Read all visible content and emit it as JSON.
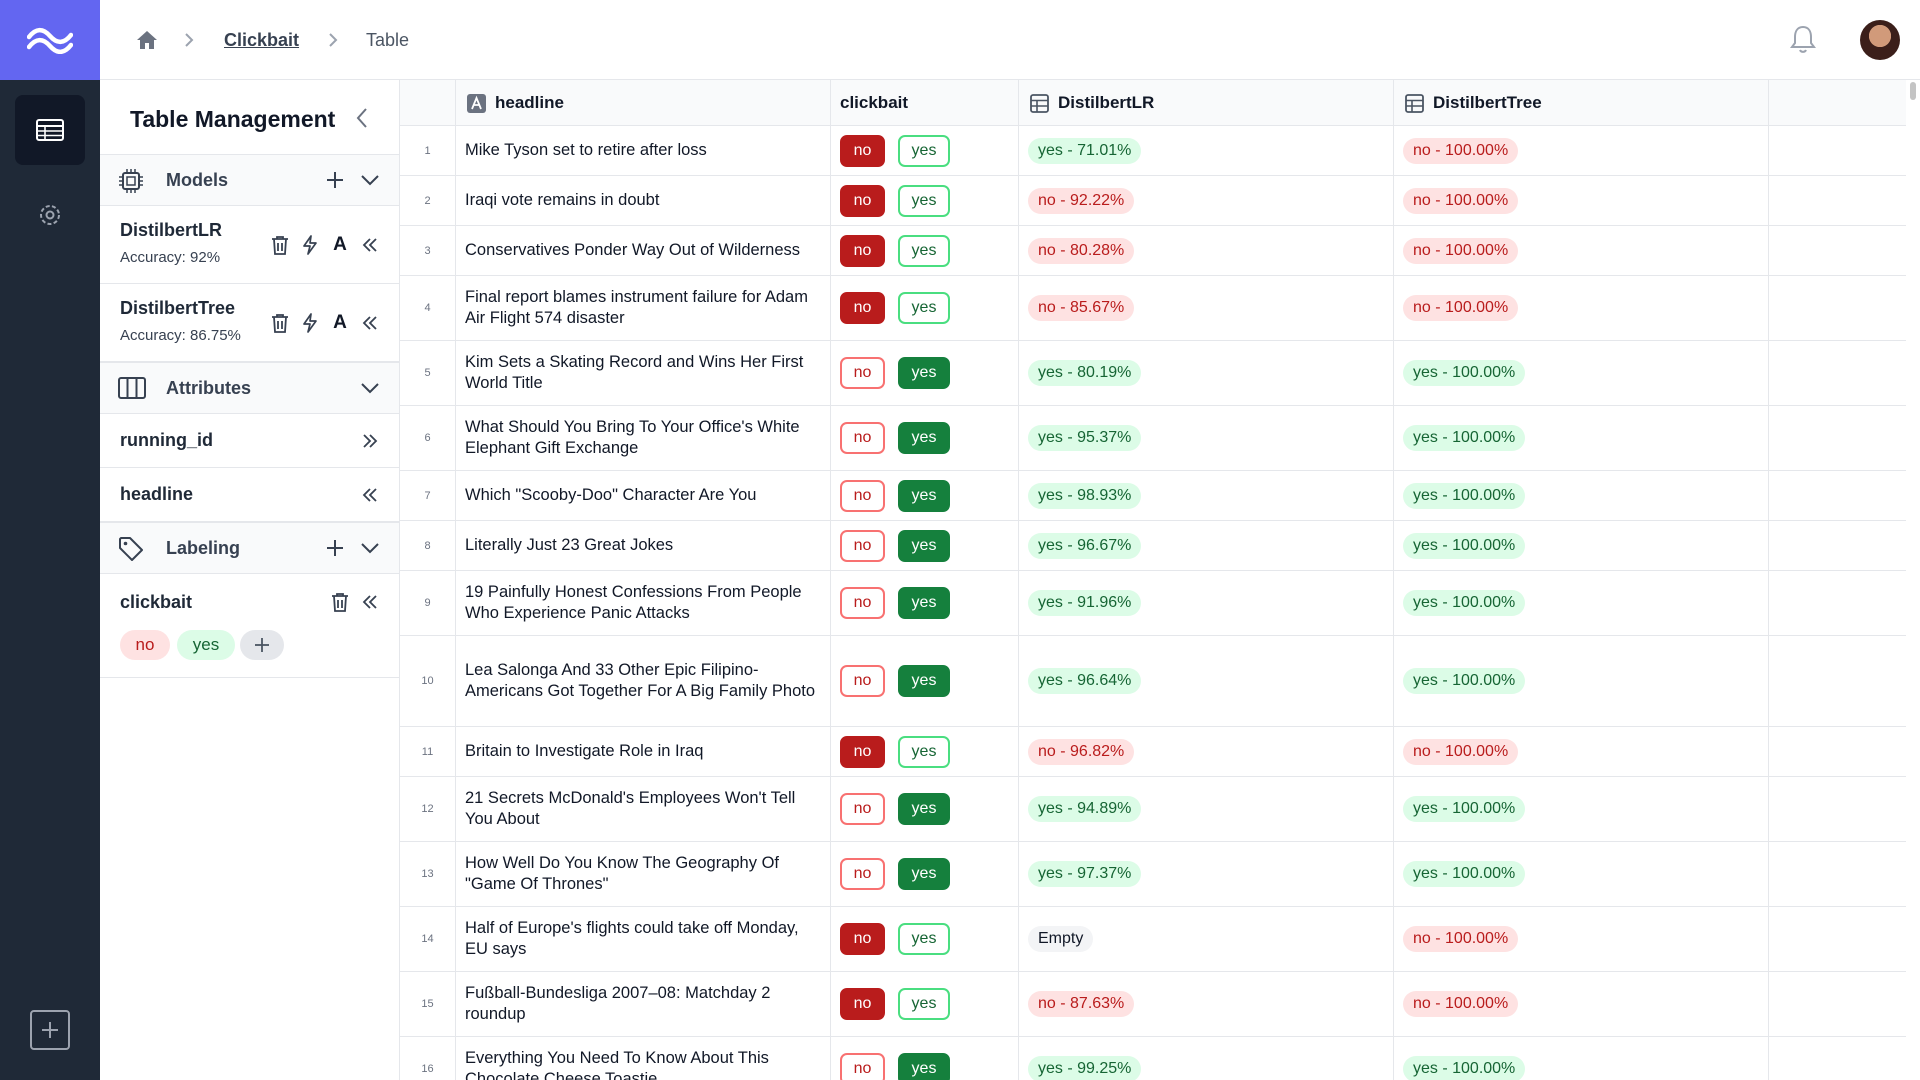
{
  "breadcrumb": {
    "project": "Clickbait",
    "current": "Table"
  },
  "panel": {
    "title": "Table Management",
    "models_label": "Models",
    "models": [
      {
        "name": "DistilbertLR",
        "accuracy": "Accuracy: 92%"
      },
      {
        "name": "DistilbertTree",
        "accuracy": "Accuracy: 86.75%"
      }
    ],
    "attributes_label": "Attributes",
    "attributes": [
      "running_id",
      "headline"
    ],
    "labeling_label": "Labeling",
    "label_task": "clickbait",
    "label_options": [
      "no",
      "yes"
    ],
    "attr_letter": "A"
  },
  "table": {
    "columns": [
      "headline",
      "clickbait",
      "DistilbertLR",
      "DistilbertTree"
    ],
    "label_no": "no",
    "label_yes": "yes",
    "rows": [
      {
        "n": "1",
        "headline": "Mike Tyson set to retire after loss",
        "label": "no",
        "lr": "yes - 71.01%",
        "lr_cls": "yes",
        "tree": "no - 100.00%",
        "tree_cls": "no",
        "h": 50
      },
      {
        "n": "2",
        "headline": "Iraqi vote remains in doubt",
        "label": "no",
        "lr": "no - 92.22%",
        "lr_cls": "no",
        "tree": "no - 100.00%",
        "tree_cls": "no",
        "h": 50
      },
      {
        "n": "3",
        "headline": "Conservatives Ponder Way Out of Wilderness",
        "label": "no",
        "lr": "no - 80.28%",
        "lr_cls": "no",
        "tree": "no - 100.00%",
        "tree_cls": "no",
        "h": 50
      },
      {
        "n": "4",
        "headline": "Final report blames instrument failure for Adam Air Flight 574 disaster",
        "label": "no",
        "lr": "no - 85.67%",
        "lr_cls": "no",
        "tree": "no - 100.00%",
        "tree_cls": "no",
        "h": 65
      },
      {
        "n": "5",
        "headline": "Kim Sets a Skating Record and Wins Her First World Title",
        "label": "yes",
        "lr": "yes - 80.19%",
        "lr_cls": "yes",
        "tree": "yes - 100.00%",
        "tree_cls": "yes",
        "h": 65
      },
      {
        "n": "6",
        "headline": "What Should You Bring To Your Office's White Elephant Gift Exchange",
        "label": "yes",
        "lr": "yes - 95.37%",
        "lr_cls": "yes",
        "tree": "yes - 100.00%",
        "tree_cls": "yes",
        "h": 65
      },
      {
        "n": "7",
        "headline": "Which \"Scooby-Doo\" Character Are You",
        "label": "yes",
        "lr": "yes - 98.93%",
        "lr_cls": "yes",
        "tree": "yes - 100.00%",
        "tree_cls": "yes",
        "h": 50
      },
      {
        "n": "8",
        "headline": "Literally Just 23 Great Jokes",
        "label": "yes",
        "lr": "yes - 96.67%",
        "lr_cls": "yes",
        "tree": "yes - 100.00%",
        "tree_cls": "yes",
        "h": 50
      },
      {
        "n": "9",
        "headline": "19 Painfully Honest Confessions From People Who Experience Panic Attacks",
        "label": "yes",
        "lr": "yes - 91.96%",
        "lr_cls": "yes",
        "tree": "yes - 100.00%",
        "tree_cls": "yes",
        "h": 65
      },
      {
        "n": "10",
        "headline": "Lea Salonga And 33 Other Epic Filipino-Americans Got Together For A Big Family Photo",
        "label": "yes",
        "lr": "yes - 96.64%",
        "lr_cls": "yes",
        "tree": "yes - 100.00%",
        "tree_cls": "yes",
        "h": 91
      },
      {
        "n": "11",
        "headline": "Britain to Investigate Role in Iraq",
        "label": "no",
        "lr": "no - 96.82%",
        "lr_cls": "no",
        "tree": "no - 100.00%",
        "tree_cls": "no",
        "h": 50
      },
      {
        "n": "12",
        "headline": "21 Secrets McDonald's Employees Won't Tell You About",
        "label": "yes",
        "lr": "yes - 94.89%",
        "lr_cls": "yes",
        "tree": "yes - 100.00%",
        "tree_cls": "yes",
        "h": 65
      },
      {
        "n": "13",
        "headline": "How Well Do You Know The Geography Of \"Game Of Thrones\"",
        "label": "yes",
        "lr": "yes - 97.37%",
        "lr_cls": "yes",
        "tree": "yes - 100.00%",
        "tree_cls": "yes",
        "h": 65
      },
      {
        "n": "14",
        "headline": "Half of Europe's flights could take off Monday, EU says",
        "label": "no",
        "lr": "Empty",
        "lr_cls": "empty",
        "tree": "no - 100.00%",
        "tree_cls": "no",
        "h": 65
      },
      {
        "n": "15",
        "headline": "Fußball-Bundesliga 2007–08: Matchday 2 roundup",
        "label": "no",
        "lr": "no - 87.63%",
        "lr_cls": "no",
        "tree": "no - 100.00%",
        "tree_cls": "no",
        "h": 65
      },
      {
        "n": "16",
        "headline": "Everything You Need To Know About This Chocolate Cheese Toastie",
        "label": "yes",
        "lr": "yes - 99.25%",
        "lr_cls": "yes",
        "tree": "yes - 100.00%",
        "tree_cls": "yes",
        "h": 65
      }
    ]
  },
  "colors": {
    "accent": "#6366f1",
    "rail": "#1f2937",
    "no_solid": "#b91c1c",
    "yes_solid": "#15803d"
  }
}
